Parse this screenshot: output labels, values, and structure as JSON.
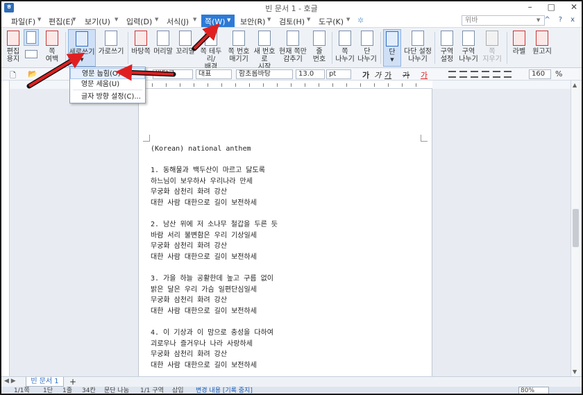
{
  "window": {
    "title": "빈 문서 1 - 호글",
    "app_icon": "ㅎ",
    "controls": [
      "–",
      "□",
      "✕"
    ]
  },
  "menu": {
    "items": [
      "파일(F)",
      "편집(E)",
      "보기(U)",
      "입력(D)",
      "서식(J)",
      "쪽(W)",
      "보안(R)",
      "검토(H)",
      "도구(K)"
    ],
    "active": "쪽(W)",
    "search_placeholder": "위바",
    "right_icons": [
      "^",
      "?",
      "x"
    ]
  },
  "ribbon": {
    "edit_paper": "편집\n용지",
    "margin": "쪽\n여백",
    "vertical": "세로쓰기",
    "horizontal": "가로쓰기",
    "bg": "바탕쪽",
    "header": "머리말",
    "footer": "꼬리말",
    "border": "쪽 테두리/\n배경",
    "hide_pnum": "쪽 번호\n매기기",
    "new_pnum": "새 번호로\n시작",
    "hide_curr": "현재 쪽만\n감추기",
    "line_num": "줄\n번호",
    "page_break": "쪽\n나누기",
    "col_break": "단\n나누기",
    "columns": "단",
    "multi_col": "다단 설정\n나누기",
    "section_set": "구역\n설정",
    "section_break": "구역\n나누기",
    "page_del": "쪽\n지우기",
    "label": "라벨",
    "grid": "원고지"
  },
  "format": {
    "style": "바탕글",
    "font_type": "대표",
    "font": "함초롬바탕",
    "size": "13.0",
    "unit": "pt",
    "bold": "가",
    "italic": "가",
    "underline": "가",
    "strike": "가",
    "color": "가",
    "zoom_value": "160",
    "zoom_unit": "%"
  },
  "dropdown": {
    "items": [
      "영문 눕힘(O)",
      "영문 세움(U)",
      "글자 방향 설정(C)..."
    ]
  },
  "document": {
    "lines": [
      "(Korean) national anthem",
      "",
      "1. 동해물과 백두산이 마르고 닳도록",
      "하느님이 보우하사 우리나라 만세",
      "무궁화 삼천리 화려 강산",
      "대한 사람 대한으로 길이 보전하세",
      "",
      "2. 남산 위에 저 소나무 철갑을 두른 듯",
      "바람 서리 불변함은 우리 기상일세",
      "무궁화 삼천리 화려 강산",
      "대한 사람 대한으로 길이 보전하세",
      "",
      "3. 가을 하늘 공활한데 높고 구름 없이",
      "밝은 달은 우리 가슴 일편단심일세",
      "무궁화 삼천리 화려 강산",
      "대한 사람 대한으로 길이 보전하세",
      "",
      "4. 이 기상과 이 맘으로 충성을 다하여",
      "괴로우나 즐거우나 나라 사랑하세",
      "무궁화 삼천리 화려 강산",
      "대한 사람 대한으로 길이 보전하세"
    ]
  },
  "tabs": {
    "doc_tab": "빈 문서 1",
    "add": "+"
  },
  "status": {
    "page": "1/1쪽",
    "col": "1단",
    "line": "1줄",
    "pos": "34칸",
    "para": "문단 나눔",
    "section": "1/1 구역",
    "mode": "삽입",
    "track": "변경 내용 [기록 중지]",
    "zoom": "80%"
  }
}
